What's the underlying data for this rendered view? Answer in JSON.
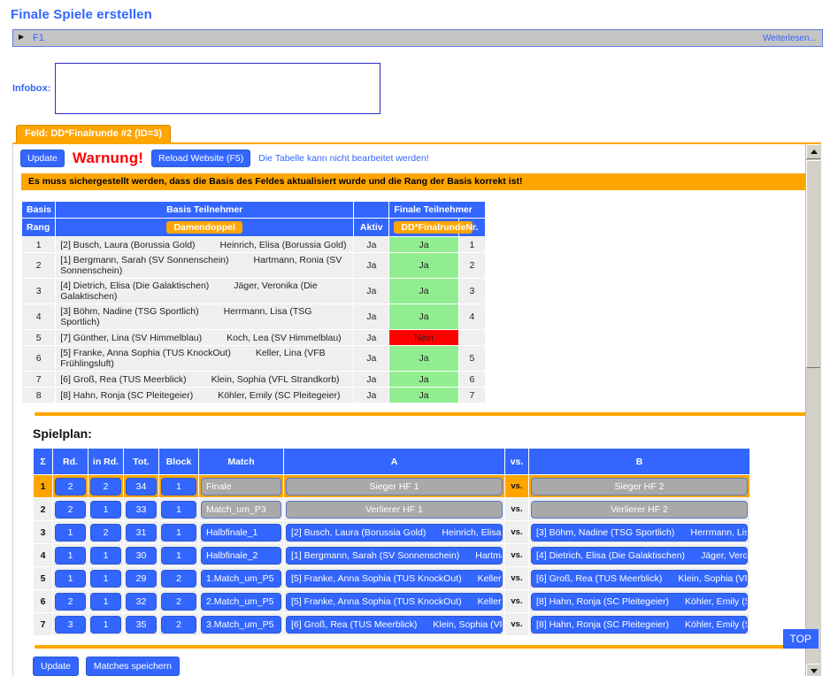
{
  "page": {
    "title": "Finale Spiele erstellen"
  },
  "accordion": {
    "arrow_icon": "triangle-right-icon",
    "label": "F1",
    "more_label": "Weiterlesen..."
  },
  "infobox": {
    "label": "Infobox:",
    "value": "",
    "placeholder": ""
  },
  "field_tab": {
    "label": "Feld: DD*Finalrunde #2 (ID=3)"
  },
  "toolbar": {
    "update_label": "Update",
    "warning_label": "Warnung!",
    "reload_label": "Reload Website (F5)",
    "hint": "Die Tabelle kann nicht bearbeitet werden!"
  },
  "notice": {
    "text": "Es muss sichergestellt werden, dass die Basis des Feldes aktualisiert wurde und die Rang der Basis korrekt ist!"
  },
  "basis_table": {
    "group_headers": [
      "Basis",
      "Basis Teilnehmer",
      "",
      "Finale Teilnehmer"
    ],
    "headers": {
      "rang": "Rang",
      "discipline": "Damendoppel",
      "aktiv": "Aktiv",
      "finale": "DD*Finalrunde",
      "nr": "Nr."
    },
    "rows": [
      {
        "rang": "1",
        "p1": "[2] Busch, Laura (Borussia Gold)",
        "p2": "Heinrich, Elisa (Borussia Gold)",
        "aktiv": "Ja",
        "finale": "Ja",
        "finale_state": "yes",
        "nr": "1"
      },
      {
        "rang": "2",
        "p1": "[1] Bergmann, Sarah (SV Sonnenschein)",
        "p2": "Hartmann, Ronia (SV Sonnenschein)",
        "aktiv": "Ja",
        "finale": "Ja",
        "finale_state": "yes",
        "nr": "2"
      },
      {
        "rang": "3",
        "p1": "[4] Dietrich, Elisa (Die Galaktischen)",
        "p2": "Jäger, Veronika (Die Galaktischen)",
        "aktiv": "Ja",
        "finale": "Ja",
        "finale_state": "yes",
        "nr": "3"
      },
      {
        "rang": "4",
        "p1": "[3] Böhm, Nadine (TSG Sportlich)",
        "p2": "Herrmann, Lisa (TSG Sportlich)",
        "aktiv": "Ja",
        "finale": "Ja",
        "finale_state": "yes",
        "nr": "4"
      },
      {
        "rang": "5",
        "p1": "[7] Günther, Lina (SV Himmelblau)",
        "p2": "Koch, Lea (SV Himmelblau)",
        "aktiv": "Ja",
        "finale": "Nein",
        "finale_state": "no",
        "nr": ""
      },
      {
        "rang": "6",
        "p1": "[5] Franke, Anna Sophia (TUS KnockOut)",
        "p2": "Keller, Lina (VFB Frühlingsluft)",
        "aktiv": "Ja",
        "finale": "Ja",
        "finale_state": "yes",
        "nr": "5"
      },
      {
        "rang": "7",
        "p1": "[6] Groß, Rea (TUS Meerblick)",
        "p2": "Klein, Sophia (VFL Strandkorb)",
        "aktiv": "Ja",
        "finale": "Ja",
        "finale_state": "yes",
        "nr": "6"
      },
      {
        "rang": "8",
        "p1": "[8] Hahn, Ronja (SC Pleitegeier)",
        "p2": "Köhler, Emily (SC Pleitegeier)",
        "aktiv": "Ja",
        "finale": "Ja",
        "finale_state": "yes",
        "nr": "7"
      }
    ]
  },
  "spielplan": {
    "title": "Spielplan:",
    "headers": {
      "sum": "Σ",
      "rd": "Rd.",
      "in_rd": "in Rd.",
      "tot": "Tot.",
      "block": "Block",
      "match": "Match",
      "a": "A",
      "vs": "vs.",
      "b": "B"
    },
    "vs_label": "vs.",
    "rows": [
      {
        "sum": "1",
        "rd": "2",
        "in_rd": "2",
        "tot": "34",
        "block": "1",
        "match": "Finale",
        "match_style": "gray",
        "a": "Sieger HF 1",
        "a_style": "gray",
        "b": "Sieger HF 2",
        "b_style": "gray",
        "highlight": true
      },
      {
        "sum": "2",
        "rd": "2",
        "in_rd": "1",
        "tot": "33",
        "block": "1",
        "match": "Match_um_P3",
        "match_style": "gray",
        "a": "Verlierer HF 1",
        "a_style": "gray",
        "b": "Verlierer HF 2",
        "b_style": "gray",
        "highlight": false
      },
      {
        "sum": "3",
        "rd": "1",
        "in_rd": "2",
        "tot": "31",
        "block": "1",
        "match": "Halbfinale_1",
        "match_style": "blue",
        "a": "[2] Busch, Laura (Borussia Gold)",
        "a2": "Heinrich, Elisa (Boru",
        "a_style": "blue",
        "b": "[3] Böhm, Nadine (TSG Sportlich)",
        "b2": "Herrmann, Lisa (T",
        "b_style": "blue",
        "highlight": false
      },
      {
        "sum": "4",
        "rd": "1",
        "in_rd": "1",
        "tot": "30",
        "block": "1",
        "match": "Halbfinale_2",
        "match_style": "blue",
        "a": "[1] Bergmann, Sarah (SV Sonnenschein)",
        "a2": "Hartmann,",
        "a_style": "blue",
        "b": "[4] Dietrich, Elisa (Die  Galaktischen)",
        "b2": "Jäger, Veronika",
        "b_style": "blue",
        "highlight": false
      },
      {
        "sum": "5",
        "rd": "1",
        "in_rd": "1",
        "tot": "29",
        "block": "2",
        "match": "1.Match_um_P5",
        "match_style": "blue",
        "a": "[5] Franke, Anna Sophia (TUS KnockOut)",
        "a2": "Keller, Lin",
        "a_style": "blue",
        "b": "[6] Groß, Rea (TUS Meerblick)",
        "b2": "Klein, Sophia (VFL St",
        "b_style": "blue",
        "highlight": false
      },
      {
        "sum": "6",
        "rd": "2",
        "in_rd": "1",
        "tot": "32",
        "block": "2",
        "match": "2.Match_um_P5",
        "match_style": "blue",
        "a": "[5] Franke, Anna Sophia (TUS KnockOut)",
        "a2": "Keller, Lin",
        "a_style": "blue",
        "b": "[8] Hahn, Ronja (SC Pleitegeier)",
        "b2": "Köhler, Emily (SC I",
        "b_style": "blue",
        "highlight": false
      },
      {
        "sum": "7",
        "rd": "3",
        "in_rd": "1",
        "tot": "35",
        "block": "2",
        "match": "3.Match_um_P5",
        "match_style": "blue",
        "a": "[6] Groß, Rea (TUS Meerblick)",
        "a2": "Klein, Sophia (VFL St",
        "a_style": "blue",
        "b": "[8] Hahn, Ronja (SC Pleitegeier)",
        "b2": "Köhler, Emily (SC I",
        "b_style": "blue",
        "highlight": false
      }
    ]
  },
  "footer": {
    "update_label": "Update",
    "save_label": "Matches speichern",
    "top_label": "TOP"
  },
  "colors": {
    "accent_blue": "#3366ff",
    "accent_orange": "#ffa500",
    "yes_green": "#90ee90",
    "no_red": "#ff0000",
    "warning_red": "#ff0000"
  }
}
